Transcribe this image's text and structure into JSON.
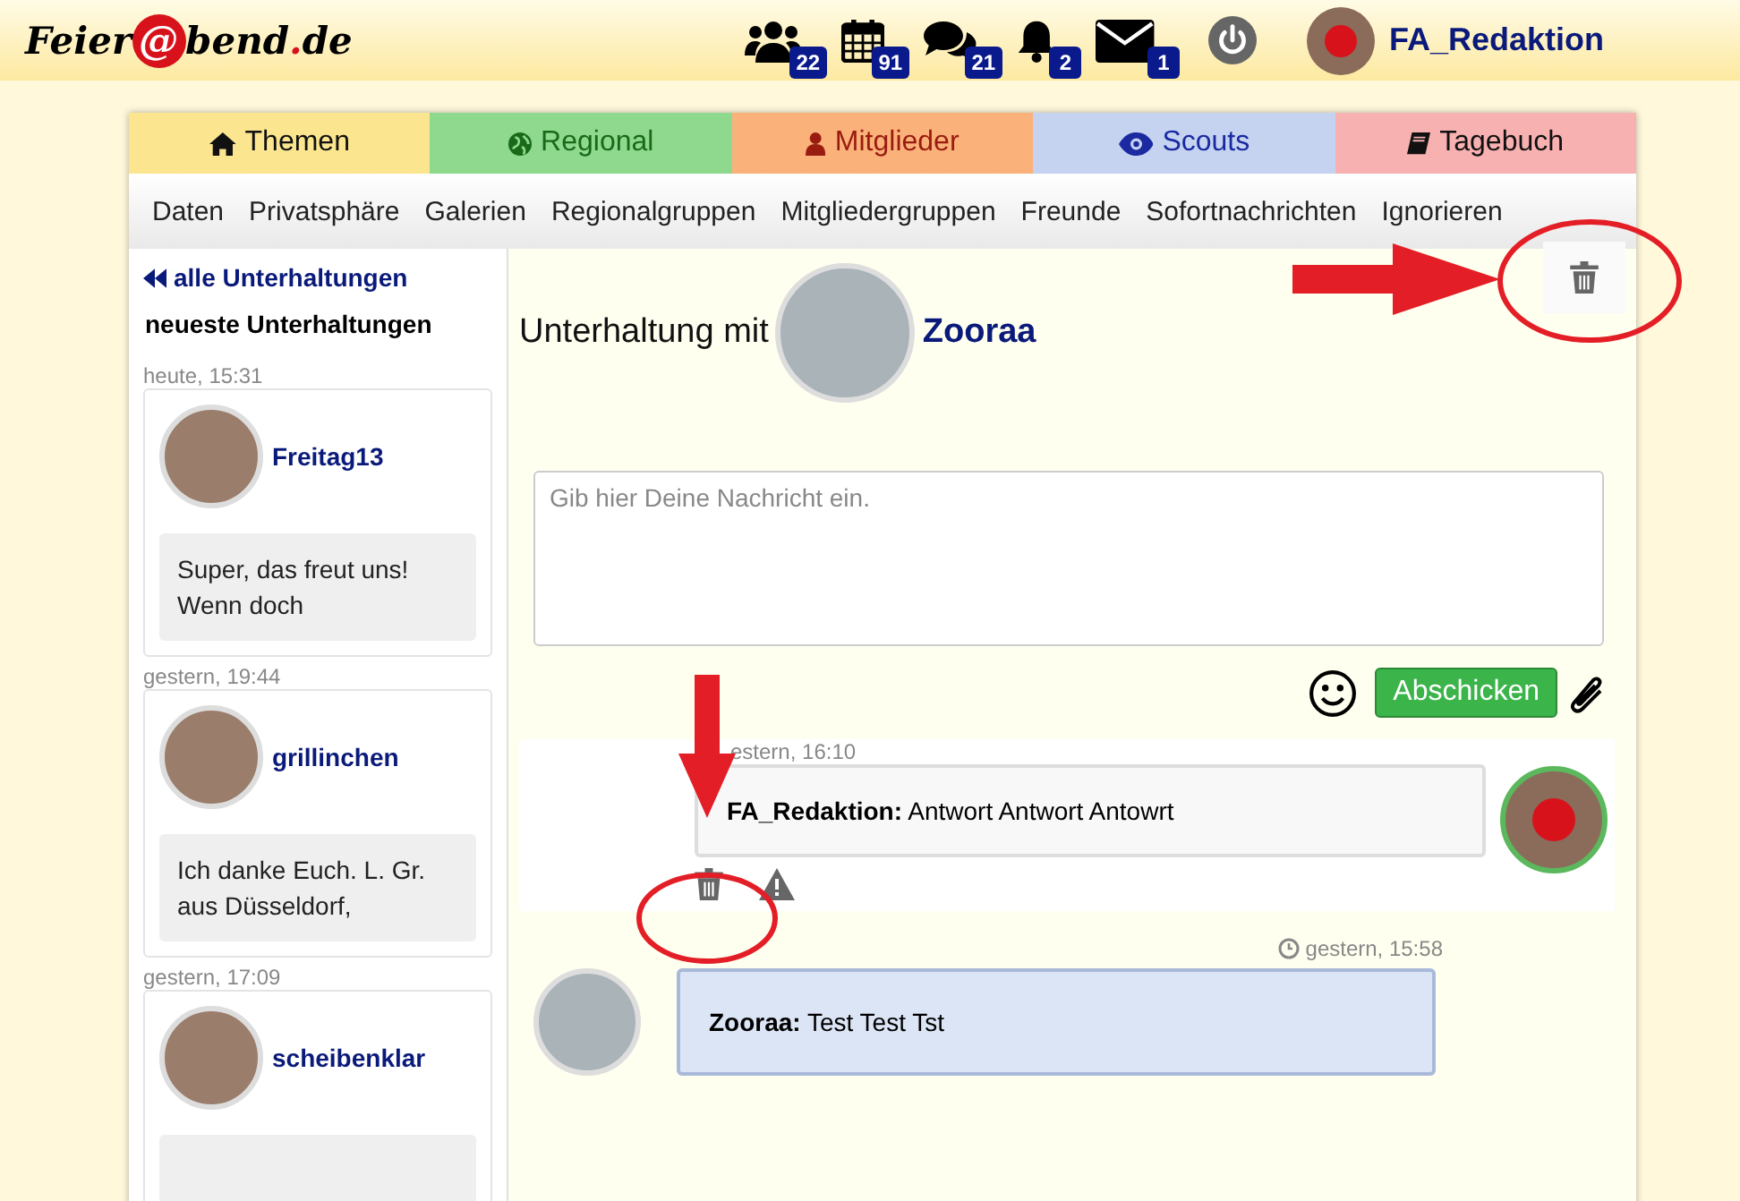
{
  "header": {
    "logo": {
      "before": "Feier",
      "at": "@",
      "after": "bend",
      "dot": ".",
      "tld": "de"
    },
    "notifications": [
      {
        "kind": "users",
        "count": "22"
      },
      {
        "kind": "calendar",
        "count": "91"
      },
      {
        "kind": "comments",
        "count": "21"
      },
      {
        "kind": "bell",
        "count": "2"
      },
      {
        "kind": "envelope",
        "count": "1"
      }
    ],
    "user": "FA_Redaktion"
  },
  "tabs": [
    {
      "label": "Themen",
      "color": "#fbe68f"
    },
    {
      "label": "Regional",
      "color": "#8fd98f"
    },
    {
      "label": "Mitglieder",
      "color": "#fbb27a"
    },
    {
      "label": "Scouts",
      "color": "#c5d3f1"
    },
    {
      "label": "Tagebuch",
      "color": "#f8b1b1"
    }
  ],
  "subnav": [
    "Daten",
    "Privatsphäre",
    "Galerien",
    "Regionalgruppen",
    "Mitgliedergruppen",
    "Freunde",
    "Sofortnachrichten",
    "Ignorieren"
  ],
  "sidebar": {
    "back_link": "alle Unterhaltungen",
    "heading": "neueste Unterhaltungen",
    "conversations": [
      {
        "time": "heute, 15:31",
        "name": "Freitag13",
        "preview": "Super, das freut uns! Wenn doch"
      },
      {
        "time": "gestern, 19:44",
        "name": "grillinchen",
        "preview": "Ich danke Euch. L. Gr. aus Düsseldorf,"
      },
      {
        "time": "gestern, 17:09",
        "name": "scheibenklar"
      }
    ]
  },
  "conversation": {
    "title": "Unterhaltung mit",
    "partner": "Zooraa",
    "placeholder": "Gib hier Deine Nachricht ein.",
    "send_button": "Abschicken",
    "messages": [
      {
        "kind": "sent",
        "time": "estern, 16:10",
        "sender": "FA_Redaktion:",
        "text": "Antwort Antwort Antowrt"
      },
      {
        "kind": "received",
        "time": "gestern, 15:58",
        "sender": "Zooraa:",
        "text": "Test Test Tst"
      }
    ]
  }
}
